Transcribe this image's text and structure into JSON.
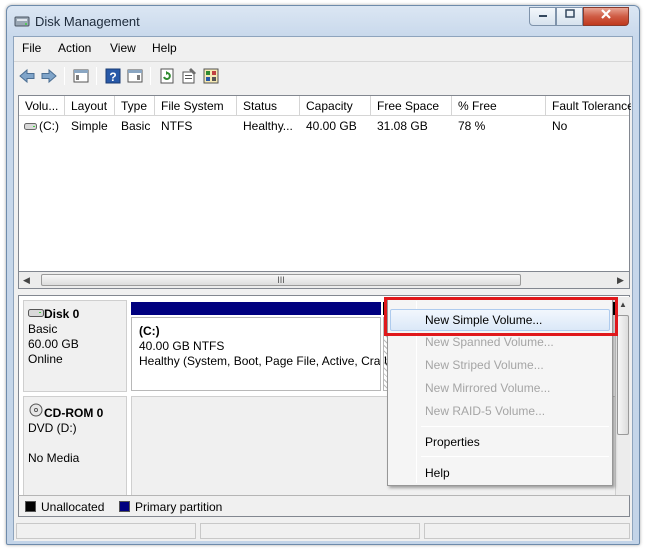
{
  "window": {
    "title": "Disk Management",
    "accent_color": "#e0181b",
    "controls": {
      "minimize_icon": "minimize-icon",
      "maximize_icon": "maximize-icon",
      "close_icon": "close-icon"
    }
  },
  "menubar": {
    "items": [
      "File",
      "Action",
      "View",
      "Help"
    ]
  },
  "toolbar": {
    "buttons": [
      "back-arrow-icon",
      "forward-arrow-icon",
      "console-tree-icon",
      "help-icon",
      "action-pane-icon",
      "refresh-icon",
      "properties-icon",
      "rescan-disks-icon"
    ]
  },
  "volume_list": {
    "columns": [
      "Volu...",
      "Layout",
      "Type",
      "File System",
      "Status",
      "Capacity",
      "Free Space",
      "% Free",
      "Fault Tolerance"
    ],
    "rows": [
      {
        "volume": "(C:)",
        "layout": "Simple",
        "type": "Basic",
        "file_system": "NTFS",
        "status": "Healthy...",
        "capacity": "40.00 GB",
        "free_space": "31.08 GB",
        "percent_free": "78 %",
        "fault_tolerance": "No"
      }
    ],
    "hscroll_grip": "III"
  },
  "disks": [
    {
      "title": "Disk 0",
      "kind": "Basic",
      "size": "60.00 GB",
      "state": "Online",
      "icon": "hard-disk-icon"
    },
    {
      "title": "CD-ROM 0",
      "kind": "DVD (D:)",
      "size": "",
      "state": "No Media",
      "icon": "cdrom-icon"
    }
  ],
  "partition": {
    "name": "(C:)",
    "size_fs": "40.00 GB NTFS",
    "status": "Healthy (System, Boot, Page File, Active, Cra",
    "color": "#00007f"
  },
  "unallocated_box_text": "U",
  "legend": {
    "items": [
      {
        "label": "Unallocated",
        "color": "#000000"
      },
      {
        "label": "Primary partition",
        "color": "#00007f"
      }
    ]
  },
  "context_menu": {
    "items": [
      {
        "label": "New Simple Volume...",
        "enabled": true
      },
      {
        "label": "New Spanned Volume...",
        "enabled": false
      },
      {
        "label": "New Striped Volume...",
        "enabled": false
      },
      {
        "label": "New Mirrored Volume...",
        "enabled": false
      },
      {
        "label": "New RAID-5 Volume...",
        "enabled": false
      },
      {
        "label": "Properties",
        "enabled": true
      },
      {
        "label": "Help",
        "enabled": true
      }
    ]
  }
}
